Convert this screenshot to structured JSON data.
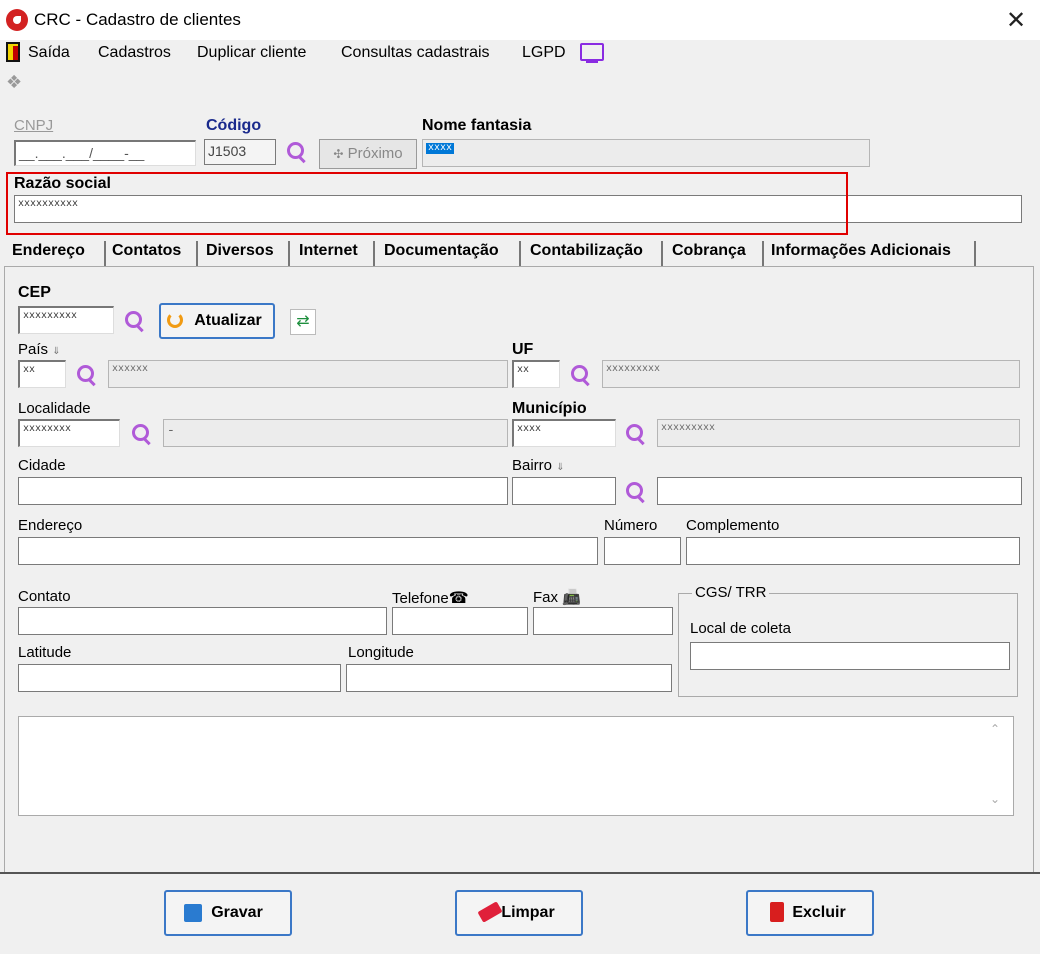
{
  "window": {
    "title": "CRC - Cadastro de clientes",
    "close_glyph": "✕"
  },
  "menu": {
    "exit": "Saída",
    "items": [
      "Cadastros",
      "Duplicar cliente",
      "Consultas cadastrais",
      "LGPD"
    ]
  },
  "header": {
    "cnpj_label": "CNPJ",
    "cnpj_mask": "__.___.___/____-__",
    "codigo_label": "Código",
    "codigo_value": "J1503",
    "next_label": "Próximo",
    "next_glyph": "✣",
    "nome_fantasia_label": "Nome fantasia",
    "nome_fantasia_value": "xxxx",
    "razao_social_label": "Razão social",
    "razao_social_value": "xxxxxxxxxx"
  },
  "tabs": [
    "Endereço",
    "Contatos",
    "Diversos",
    "Internet",
    "Documentação",
    "Contabilização",
    "Cobrança",
    "Informações Adicionais"
  ],
  "address": {
    "cep_label": "CEP",
    "cep_value": "xxxxxxxxx",
    "update_button": "Atualizar",
    "pais_label": "País",
    "pais_value": "xx",
    "pais_desc": "xxxxxx",
    "uf_label": "UF",
    "uf_value": "xx",
    "uf_desc": "xxxxxxxxx",
    "localidade_label": "Localidade",
    "localidade_value": "xxxxxxxx",
    "localidade_desc": "-",
    "municipio_label": "Município",
    "municipio_value": "xxxx",
    "municipio_desc": "xxxxxxxxx",
    "cidade_label": "Cidade",
    "cidade_value": "",
    "bairro_label": "Bairro",
    "bairro_value": "",
    "bairro_desc": "",
    "endereco_label": "Endereço",
    "endereco_value": "",
    "numero_label": "Número",
    "numero_value": "",
    "complemento_label": "Complemento",
    "complemento_value": "",
    "contato_label": "Contato",
    "contato_value": "",
    "telefone_label": "Telefone",
    "fax_label": "Fax",
    "telefone_value": "",
    "fax_value": "",
    "latitude_label": "Latitude",
    "latitude_value": "",
    "longitude_label": "Longitude",
    "longitude_value": "",
    "cgs_group": "CGS/ TRR",
    "local_coleta_label": "Local de coleta",
    "local_coleta_value": "",
    "memo_value": "",
    "down_arrow": "⇓",
    "phone_glyph": "☎",
    "fax_glyph": "📠",
    "scroll_up_glyph": "⌃",
    "scroll_down_glyph": "⌄"
  },
  "footer": {
    "save": "Gravar",
    "clear": "Limpar",
    "delete": "Excluir"
  },
  "colors": {
    "accent_purple": "#b05ad8",
    "highlight_red": "#e00000",
    "button_border": "#3b78c7"
  }
}
